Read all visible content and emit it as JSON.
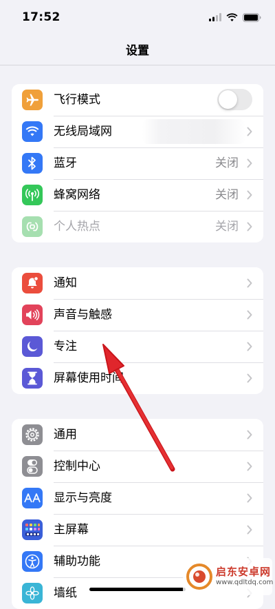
{
  "status_bar": {
    "time": "17:52"
  },
  "nav": {
    "title": "设置"
  },
  "groups": [
    {
      "rows": [
        {
          "label": "飞行模式",
          "icon": "airplane-icon",
          "icon_color": "#f0a03a",
          "control": "toggle",
          "toggle_on": false
        },
        {
          "label": "无线局域网",
          "icon": "wifi-icon",
          "icon_color": "#3478f6",
          "value_blurred": true
        },
        {
          "label": "蓝牙",
          "value": "关闭",
          "icon": "bluetooth-icon",
          "icon_color": "#3478f6"
        },
        {
          "label": "蜂窝网络",
          "value": "关闭",
          "icon": "antenna-icon",
          "icon_color": "#34c759"
        },
        {
          "label": "个人热点",
          "value": "关闭",
          "icon": "hotspot-icon",
          "icon_color": "#a6dfb0",
          "disabled": true
        }
      ]
    },
    {
      "rows": [
        {
          "label": "通知",
          "icon": "bell-icon",
          "icon_color": "#eb4d3d"
        },
        {
          "label": "声音与触感",
          "icon": "speaker-icon",
          "icon_color": "#e2435a"
        },
        {
          "label": "专注",
          "icon": "moon-icon",
          "icon_color": "#5b59d6"
        },
        {
          "label": "屏幕使用时间",
          "icon": "hourglass-icon",
          "icon_color": "#5b59d6"
        }
      ]
    },
    {
      "rows": [
        {
          "label": "通用",
          "icon": "gear-icon",
          "icon_color": "#8e8e93"
        },
        {
          "label": "控制中心",
          "icon": "toggles-icon",
          "icon_color": "#8e8e93"
        },
        {
          "label": "显示与亮度",
          "icon": "text-size-icon",
          "icon_color": "#3478f6"
        },
        {
          "label": "主屏幕",
          "icon": "app-grid-icon",
          "icon_color": "#3a5fd9"
        },
        {
          "label": "辅助功能",
          "icon": "accessibility-icon",
          "icon_color": "#3478f6"
        },
        {
          "label": "墙纸",
          "icon": "wallpaper-icon",
          "icon_color": "#3ab5d6"
        }
      ]
    }
  ],
  "annotation": {
    "type": "arrow",
    "color": "#e0262c",
    "target": "专注"
  },
  "watermark": {
    "title": "启东安卓网",
    "url": "www.qdltdq.com"
  }
}
